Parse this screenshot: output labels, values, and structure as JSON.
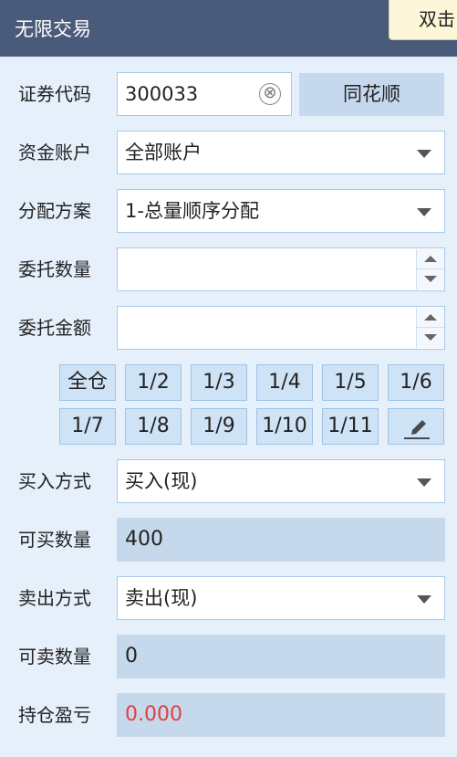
{
  "title": "无限交易",
  "tooltip": "双击",
  "code": {
    "label": "证券代码",
    "value": "300033",
    "clear_icon": "⊗",
    "name": "同花顺"
  },
  "account": {
    "label": "资金账户",
    "value": "全部账户"
  },
  "allocation": {
    "label": "分配方案",
    "value": "1-总量顺序分配"
  },
  "entrust_qty": {
    "label": "委托数量",
    "value": ""
  },
  "entrust_amount": {
    "label": "委托金额",
    "value": ""
  },
  "fractions": [
    "全仓",
    "1/2",
    "1/3",
    "1/4",
    "1/5",
    "1/6",
    "1/7",
    "1/8",
    "1/9",
    "1/10",
    "1/11"
  ],
  "buy_method": {
    "label": "买入方式",
    "value": "买入(现)"
  },
  "buyable": {
    "label": "可买数量",
    "value": "400"
  },
  "sell_method": {
    "label": "卖出方式",
    "value": "卖出(现)"
  },
  "sellable": {
    "label": "可卖数量",
    "value": "0"
  },
  "pnl": {
    "label": "持仓盈亏",
    "value": "0.000",
    "color": "#e04040"
  },
  "icons": {
    "edit": "pencil-edit-icon",
    "clear": "clear-circle-icon",
    "dropdown": "caret-down-icon"
  }
}
